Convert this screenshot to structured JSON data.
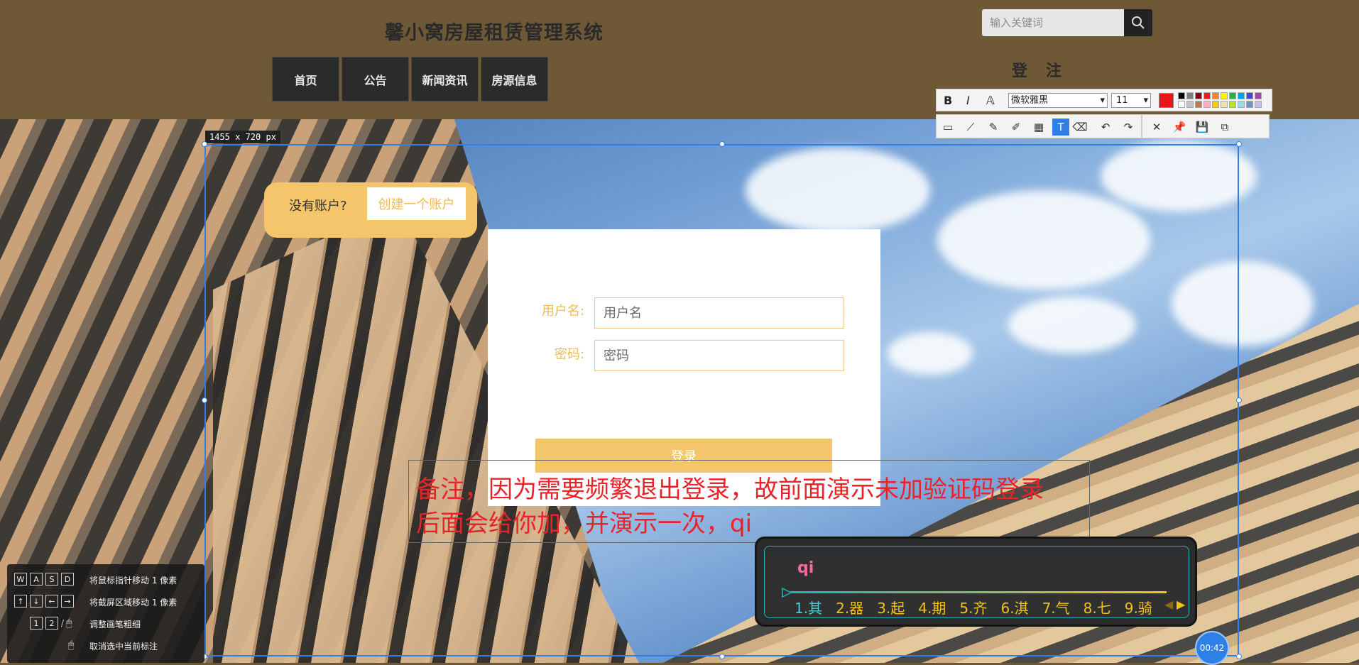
{
  "site": {
    "title": "馨小窝房屋租赁管理系统",
    "nav": [
      "首页",
      "公告",
      "新闻资讯",
      "房源信息"
    ],
    "search_placeholder": "输入关键词",
    "auth_login": "登",
    "auth_register": "注"
  },
  "capture": {
    "size_label": "1455 x 720  px"
  },
  "signup": {
    "prompt": "没有账户?",
    "link": "创建一个账户"
  },
  "login": {
    "username_label": "用户名:",
    "username_placeholder": "用户名",
    "password_label": "密码:",
    "password_placeholder": "密码",
    "submit": "登录"
  },
  "annotation": {
    "line1": "备注，因为需要频繁退出登录，故前面演示未加验证码登录",
    "line2": "后面会给你加，并演示一次，qi"
  },
  "format_toolbar": {
    "bold": "B",
    "italic": "I",
    "font": "微软雅黑",
    "size": "11",
    "current_color": "#e8151b",
    "palette": [
      "#000000",
      "#7f7f7f",
      "#880015",
      "#ed1c24",
      "#ff7f27",
      "#fff200",
      "#22b14c",
      "#00a2e8",
      "#3f48cc",
      "#a349a4",
      "#ffffff",
      "#c3c3c3",
      "#b97a57",
      "#ffaec9",
      "#ffc90e",
      "#efe4b0",
      "#b5e61d",
      "#99d9ea",
      "#7092be",
      "#c8bfe7"
    ]
  },
  "tools": [
    "rect-icon",
    "line-icon",
    "pen-icon",
    "marker-icon",
    "mosaic-icon",
    "text-icon",
    "eraser-icon",
    "undo-icon",
    "redo-icon",
    "close-icon",
    "pin-icon",
    "save-icon",
    "copy-icon"
  ],
  "help": [
    {
      "keys": [
        "W",
        "A",
        "S",
        "D"
      ],
      "text": "将鼠标指针移动 1 像素"
    },
    {
      "keys": [
        "↑",
        "↓",
        "←",
        "→"
      ],
      "text": "将截屏区域移动 1 像素"
    },
    {
      "keys": [
        "1",
        "2"
      ],
      "text": "调整画笔粗细"
    },
    {
      "keys": [],
      "text": "取消选中当前标注"
    }
  ],
  "ime": {
    "composition": "qi",
    "candidates": [
      "1.其",
      "2.器",
      "3.起",
      "4.期",
      "5.齐",
      "6.淇",
      "7.气",
      "8.七",
      "9.骑"
    ]
  },
  "timer": "00:42"
}
